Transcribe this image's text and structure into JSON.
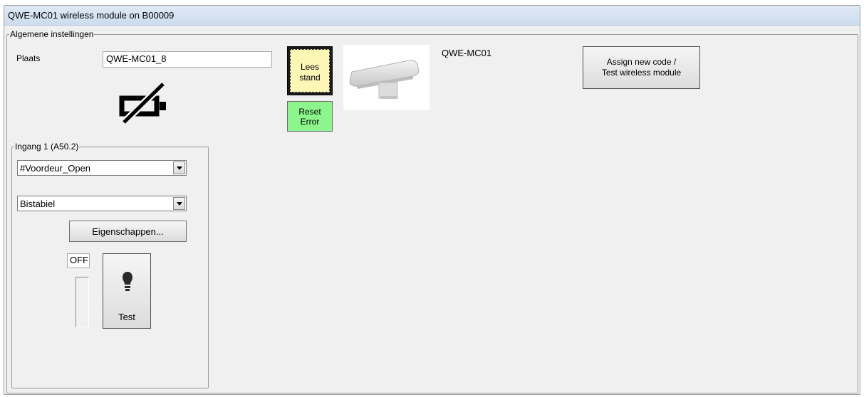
{
  "window": {
    "title": "QWE-MC01 wireless module on B00009"
  },
  "general": {
    "group_title": "Algemene instellingen",
    "place_label": "Plaats",
    "place_value": "QWE-MC01_8",
    "battery_icon": "battery-empty-crossed-icon",
    "read_button": {
      "line1": "Lees",
      "line2": "stand"
    },
    "reset_button": {
      "line1": "Reset",
      "line2": "Error",
      "color": "#8cf58c"
    },
    "module_name": "QWE-MC01",
    "module_image": "wireless-module-photo",
    "assign_button": {
      "line1": "Assign new code /",
      "line2": "Test wireless module"
    }
  },
  "input1": {
    "group_title": "Ingang 1 (A50.2)",
    "signal_select": "#Voordeur_Open",
    "mode_select": "Bistabiel",
    "properties_button": "Eigenschappen...",
    "state_value": "OFF",
    "test_icon": "light-bulb-icon",
    "test_button": "Test"
  },
  "colors": {
    "read_button_bg": "#fdf7b6",
    "reset_button_bg": "#8cf58c",
    "titlebar": "#d6e2f0"
  }
}
